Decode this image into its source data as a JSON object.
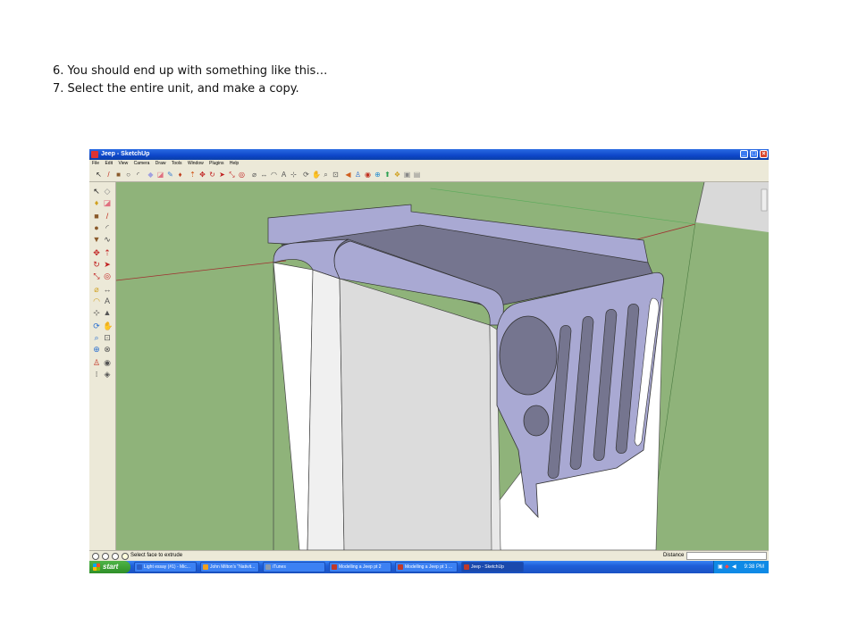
{
  "caption": {
    "line1": "6. You should end up with something like this…",
    "line2": "7. Select the entire unit, and make a copy."
  },
  "window": {
    "title": "Jeep - SketchUp",
    "controls": [
      "minimize",
      "maximize",
      "close"
    ]
  },
  "menu": [
    "File",
    "Edit",
    "View",
    "Camera",
    "Draw",
    "Tools",
    "Window",
    "Plugins",
    "Help"
  ],
  "toolbar_icons": [
    "select-icon",
    "eraser-icon",
    "line-icon",
    "rectangle-icon",
    "circle-icon",
    "arc-icon",
    "polygon-icon",
    "freehand-icon",
    "paint-bucket-icon",
    "push-pull-icon",
    "move-icon",
    "rotate-icon",
    "follow-me-icon",
    "scale-icon",
    "offset-icon",
    "tape-measure-icon",
    "dimension-icon",
    "protractor-icon",
    "text-icon",
    "axes-icon",
    "section-plane-icon",
    "orbit-icon",
    "pan-icon",
    "zoom-icon",
    "zoom-window-icon",
    "zoom-extents-icon",
    "previous-view-icon",
    "next-view-icon",
    "walk-icon",
    "look-around-icon",
    "position-camera-icon",
    "get-models-icon",
    "share-model-icon",
    "components-icon"
  ],
  "status": {
    "hint": "Select face to extrude",
    "distance_label": "Distance",
    "distance_value": ""
  },
  "taskbar": {
    "start": "start",
    "tasks": [
      {
        "label": "Light essay (#1) - Mic...",
        "active": false,
        "color": "#2a5fc9"
      },
      {
        "label": "John Milton's \"Nativit...",
        "active": false,
        "color": "#f0a020"
      },
      {
        "label": "iTunes",
        "active": false,
        "color": "#8a9ab0"
      },
      {
        "label": "Modelling a Jeep pt 2",
        "active": false,
        "color": "#c0392b"
      },
      {
        "label": "Modelling a Jeep pt 1 ...",
        "active": false,
        "color": "#c0392b"
      },
      {
        "label": "Jeep - SketchUp",
        "active": true,
        "color": "#c0392b"
      }
    ],
    "clock": "9:38 PM"
  },
  "colors": {
    "ground": "#8fb37a",
    "model_face": "#a9a9d3",
    "model_top": "#75758f",
    "wall_white": "#ffffff",
    "xp_blue": "#1f5fd8"
  }
}
